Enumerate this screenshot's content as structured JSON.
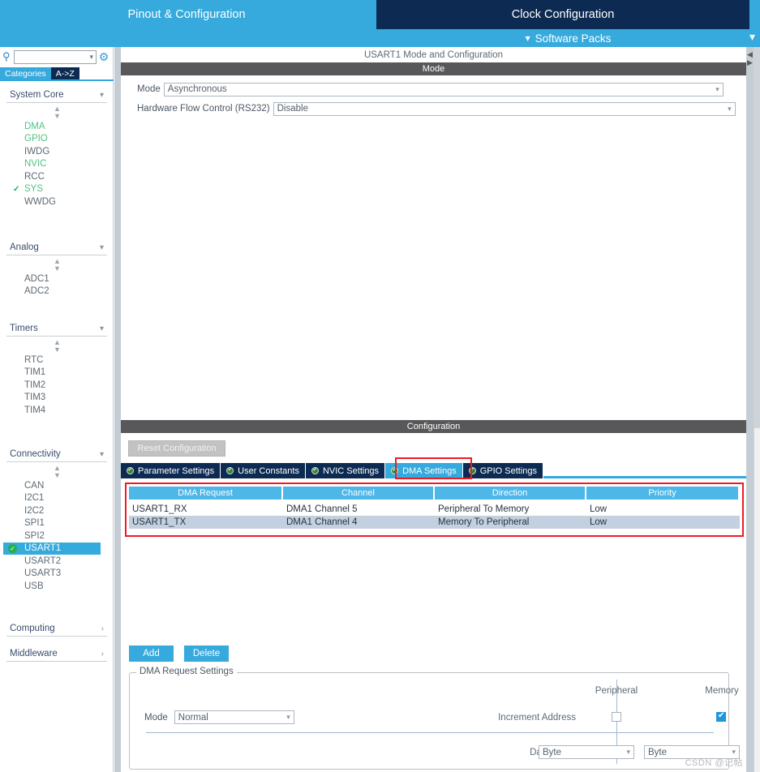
{
  "app": {
    "watermark": "CSDN @记帖"
  },
  "topbar": {
    "tabs": [
      {
        "label": "Pinout & Configuration",
        "active": false
      },
      {
        "label": "Clock Configuration",
        "active": true
      }
    ],
    "software_packs": {
      "label": "Software Packs",
      "chevron_icon": "chevron-down-icon"
    }
  },
  "sidebar": {
    "search": {
      "value": "",
      "placeholder": "",
      "icon": "search-icon"
    },
    "gear_icon": "gear-icon",
    "tabs": [
      {
        "label": "Categories",
        "selected": false
      },
      {
        "label": "A->Z",
        "selected": true
      }
    ],
    "groups": [
      {
        "name": "System Core",
        "expanded": true,
        "items": [
          {
            "label": "DMA",
            "state": "configured"
          },
          {
            "label": "GPIO",
            "state": "configured"
          },
          {
            "label": "IWDG",
            "state": "none"
          },
          {
            "label": "NVIC",
            "state": "configured"
          },
          {
            "label": "RCC",
            "state": "none"
          },
          {
            "label": "SYS",
            "state": "checked"
          },
          {
            "label": "WWDG",
            "state": "none"
          }
        ]
      },
      {
        "name": "Analog",
        "expanded": true,
        "items": [
          {
            "label": "ADC1",
            "state": "none"
          },
          {
            "label": "ADC2",
            "state": "none"
          }
        ]
      },
      {
        "name": "Timers",
        "expanded": true,
        "items": [
          {
            "label": "RTC",
            "state": "none"
          },
          {
            "label": "TIM1",
            "state": "none"
          },
          {
            "label": "TIM2",
            "state": "none"
          },
          {
            "label": "TIM3",
            "state": "none"
          },
          {
            "label": "TIM4",
            "state": "none"
          }
        ]
      },
      {
        "name": "Connectivity",
        "expanded": true,
        "items": [
          {
            "label": "CAN",
            "state": "none"
          },
          {
            "label": "I2C1",
            "state": "none"
          },
          {
            "label": "I2C2",
            "state": "none"
          },
          {
            "label": "SPI1",
            "state": "none"
          },
          {
            "label": "SPI2",
            "state": "none"
          },
          {
            "label": "USART1",
            "state": "selected"
          },
          {
            "label": "USART2",
            "state": "none"
          },
          {
            "label": "USART3",
            "state": "none"
          },
          {
            "label": "USB",
            "state": "none"
          }
        ]
      },
      {
        "name": "Computing",
        "expanded": false,
        "items": []
      },
      {
        "name": "Middleware",
        "expanded": false,
        "items": []
      }
    ]
  },
  "main": {
    "panel_title": "USART1 Mode and Configuration",
    "mode_band": "Mode",
    "fields": [
      {
        "label": "Mode",
        "value": "Asynchronous"
      },
      {
        "label": "Hardware Flow Control (RS232)",
        "value": "Disable"
      }
    ],
    "configuration_band": "Configuration",
    "reset_button": "Reset Configuration",
    "tabs": [
      {
        "label": "Parameter Settings",
        "active": false
      },
      {
        "label": "User Constants",
        "active": false
      },
      {
        "label": "NVIC Settings",
        "active": false
      },
      {
        "label": "DMA Settings",
        "active": true
      },
      {
        "label": "GPIO Settings",
        "active": false
      }
    ],
    "dma_table": {
      "columns": [
        "DMA Request",
        "Channel",
        "Direction",
        "Priority"
      ],
      "rows": [
        [
          "USART1_RX",
          "DMA1 Channel 5",
          "Peripheral To Memory",
          "Low"
        ],
        [
          "USART1_TX",
          "DMA1 Channel 4",
          "Memory To Peripheral",
          "Low"
        ]
      ]
    },
    "buttons": {
      "add": "Add",
      "delete": "Delete"
    },
    "request_settings": {
      "legend": "DMA Request Settings",
      "col_peripheral": "Peripheral",
      "col_memory": "Memory",
      "mode_label": "Mode",
      "mode_value": "Normal",
      "increment_label": "Increment Address",
      "increment_peripheral_checked": false,
      "increment_memory_checked": true,
      "data_width_label": "Data Width",
      "data_width_peripheral": "Byte",
      "data_width_memory": "Byte"
    }
  },
  "colors": {
    "accent_blue": "#36a9dd",
    "dark_navy": "#0d2b52",
    "band_gray": "#58585a",
    "highlight_red": "#ed1c24",
    "table_header": "#4db7e8",
    "row_alt": "#c3d0e0",
    "green_text": "#52c281"
  }
}
